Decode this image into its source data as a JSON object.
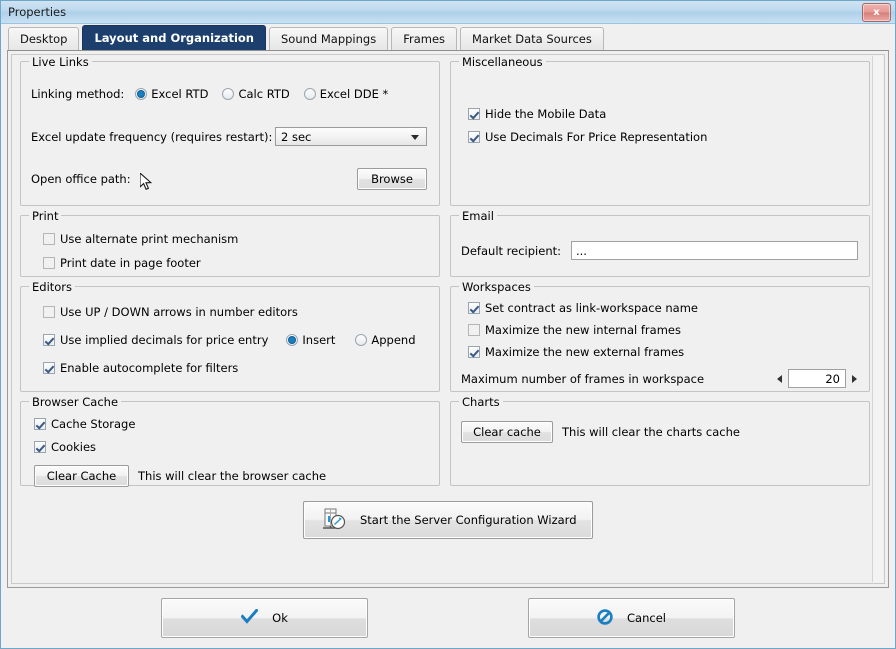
{
  "window": {
    "title": "Properties",
    "close_label": "x",
    "accent_color": "#1c3f6e",
    "border_color": "#6ea8c8"
  },
  "tabs": [
    {
      "label": "Desktop",
      "active": false
    },
    {
      "label": "Layout and Organization",
      "active": true
    },
    {
      "label": "Sound Mappings",
      "active": false
    },
    {
      "label": "Frames",
      "active": false
    },
    {
      "label": "Market Data Sources",
      "active": false
    }
  ],
  "live_links": {
    "legend": "Live Links",
    "linking_method_label": "Linking method:",
    "options": [
      {
        "label": "Excel RTD",
        "selected": true
      },
      {
        "label": "Calc RTD",
        "selected": false
      },
      {
        "label": "Excel DDE *",
        "selected": false
      }
    ],
    "update_frequency_label": "Excel update frequency (requires restart):",
    "update_frequency_value": "2 sec",
    "open_office_path_label": "Open office path:",
    "browse_label": "Browse"
  },
  "miscellaneous": {
    "legend": "Miscellaneous",
    "items": [
      {
        "label": "Hide the Mobile Data",
        "checked": true
      },
      {
        "label": "Use Decimals For Price Representation",
        "checked": true
      }
    ]
  },
  "print": {
    "legend": "Print",
    "items": [
      {
        "label": "Use alternate print mechanism",
        "checked": false
      },
      {
        "label": "Print date in page footer",
        "checked": false
      }
    ]
  },
  "email": {
    "legend": "Email",
    "recipient_label": "Default recipient:",
    "recipient_value": "..."
  },
  "editors": {
    "legend": "Editors",
    "up_down_label": "Use UP / DOWN arrows in number editors",
    "up_down_checked": false,
    "implied_decimals_label": "Use implied decimals for price entry",
    "implied_decimals_checked": true,
    "mode_options": [
      {
        "label": "Insert",
        "selected": true
      },
      {
        "label": "Append",
        "selected": false
      }
    ],
    "autocomplete_label": "Enable autocomplete for filters",
    "autocomplete_checked": true
  },
  "workspaces": {
    "legend": "Workspaces",
    "items": [
      {
        "label": "Set contract as link-workspace name",
        "checked": true
      },
      {
        "label": "Maximize the new internal frames",
        "checked": false
      },
      {
        "label": "Maximize the new external frames",
        "checked": true
      }
    ],
    "max_frames_label": "Maximum number of frames in workspace",
    "max_frames_value": "20"
  },
  "browser_cache": {
    "legend": "Browser Cache",
    "items": [
      {
        "label": "Cache Storage",
        "checked": true
      },
      {
        "label": "Cookies",
        "checked": true
      }
    ],
    "clear_button": "Clear Cache",
    "hint": "This will clear the browser cache"
  },
  "charts": {
    "legend": "Charts",
    "clear_button": "Clear cache",
    "hint": "This will clear the charts cache"
  },
  "wizard": {
    "label": "Start the Server Configuration Wizard",
    "icon": "server-wizard-icon"
  },
  "footer": {
    "ok_label": "Ok",
    "ok_icon": "check-icon",
    "cancel_label": "Cancel",
    "cancel_icon": "no-entry-icon",
    "icon_color": "#1a7fc1"
  }
}
